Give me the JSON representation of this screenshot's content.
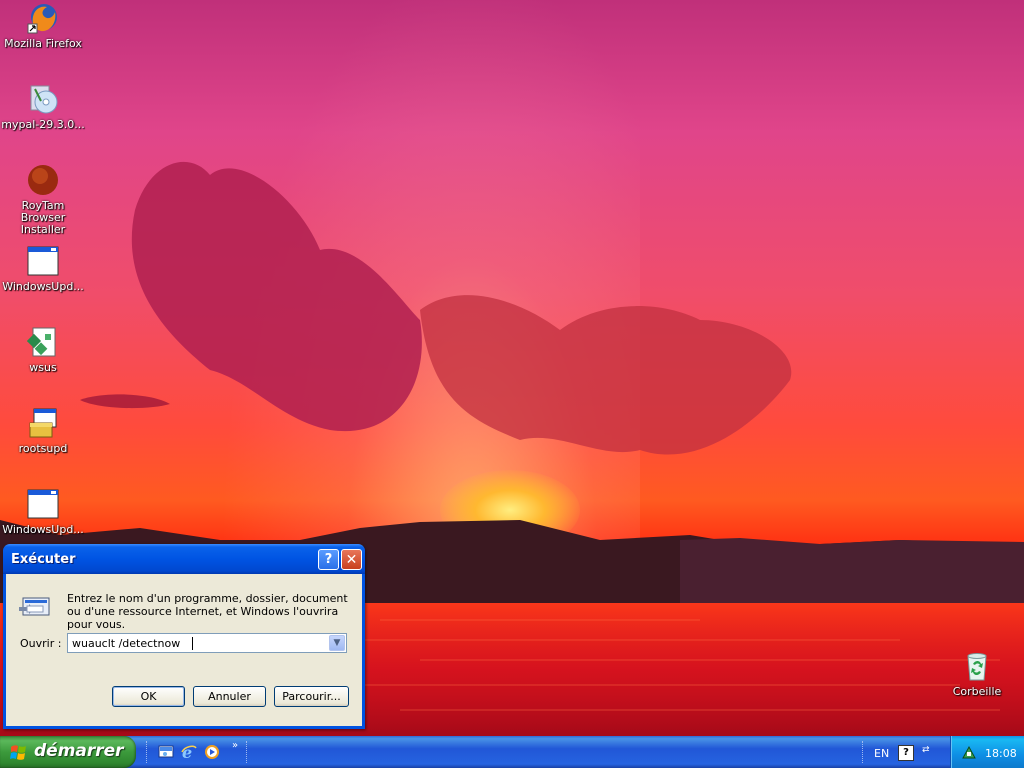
{
  "desktop": {
    "icons": [
      {
        "label": "Mozilla Firefox"
      },
      {
        "label": "mypal-29.3.0..."
      },
      {
        "label": "RoyTam Browser Installer"
      },
      {
        "label": "WindowsUpd..."
      },
      {
        "label": "wsus"
      },
      {
        "label": "rootsupd"
      },
      {
        "label": "WindowsUpd..."
      },
      {
        "label": "Corbeille"
      }
    ]
  },
  "run_dialog": {
    "title": "Exécuter",
    "description": "Entrez le nom d'un programme, dossier, document ou d'une ressource Internet, et Windows l'ouvrira pour vous.",
    "open_label": "Ouvrir :",
    "command_value": "wuauclt /detectnow",
    "ok_label": "OK",
    "cancel_label": "Annuler",
    "browse_label": "Parcourir...",
    "help_glyph": "?",
    "close_glyph": "✕"
  },
  "taskbar": {
    "start_label": "démarrer",
    "quicklaunch_chevron": "»",
    "language": "EN",
    "help_glyph": "?",
    "clock": "18:08"
  },
  "colors": {
    "titlebar": "#0054e3",
    "start_button": "#3c9a3c",
    "taskbar": "#2157d7",
    "tray": "#0e8ee5",
    "dialog_face": "#ece9d8"
  }
}
